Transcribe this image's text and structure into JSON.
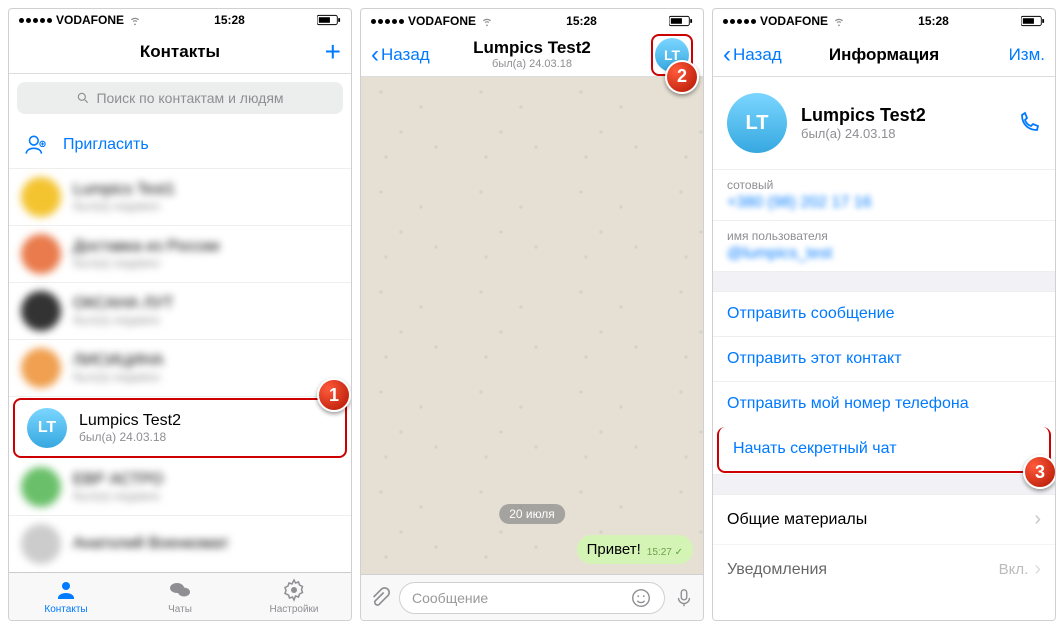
{
  "status": {
    "carrier": "VODAFONE",
    "time": "15:28"
  },
  "screen1": {
    "title": "Контакты",
    "search_placeholder": "Поиск по контактам и людям",
    "invite": "Пригласить",
    "selected": {
      "initials": "LT",
      "name": "Lumpics Test2",
      "status": "был(а) 24.03.18"
    },
    "tabs": {
      "contacts": "Контакты",
      "chats": "Чаты",
      "settings": "Настройки"
    }
  },
  "screen2": {
    "back": "Назад",
    "title": "Lumpics Test2",
    "subtitle": "был(а) 24.03.18",
    "initials": "LT",
    "date_pill": "20 июля",
    "bubble": "Привет!",
    "bubble_time": "15:27",
    "input_placeholder": "Сообщение"
  },
  "screen3": {
    "back": "Назад",
    "title": "Информация",
    "edit": "Изм.",
    "initials": "LT",
    "name": "Lumpics Test2",
    "status": "был(а) 24.03.18",
    "mobile_label": "сотовый",
    "mobile_value": "+380 (98) 202 17 16",
    "username_label": "имя пользователя",
    "username_value": "@lumpics_test",
    "actions": {
      "send_msg": "Отправить сообщение",
      "send_contact": "Отправить этот контакт",
      "send_number": "Отправить мой номер телефона",
      "secret_chat": "Начать секретный чат",
      "shared": "Общие материалы",
      "notifications": "Уведомления",
      "notifications_state": "Вкл."
    }
  },
  "markers": {
    "m1": "1",
    "m2": "2",
    "m3": "3"
  }
}
